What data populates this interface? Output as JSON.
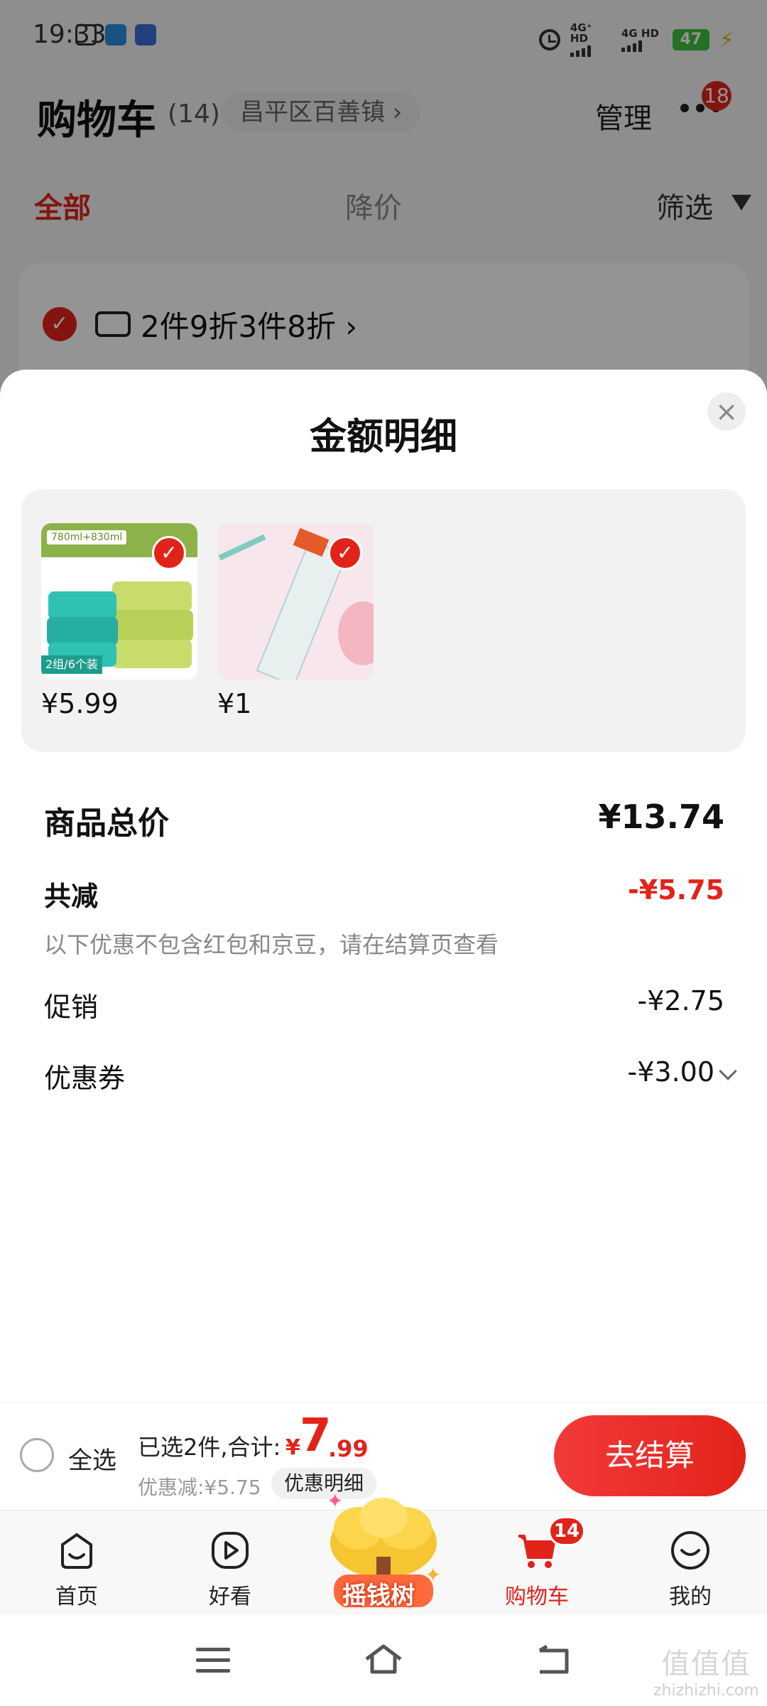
{
  "status_bar": {
    "time": "19:33",
    "signal1": "4G⁺ HD",
    "signal2": "4G HD",
    "battery": "47"
  },
  "header": {
    "title": "购物车",
    "count": "(14)",
    "location": "昌平区百善镇 ›",
    "manage": "管理",
    "badge": "18"
  },
  "tabs": {
    "all": "全部",
    "price_drop": "降价",
    "filter": "筛选"
  },
  "promo": {
    "text": "2件9折3件8折 ›"
  },
  "sheet": {
    "title": "金额明细",
    "close": "×",
    "items": [
      {
        "price": "¥5.99",
        "label_top": "780ml+830ml",
        "label_bottom": "2组/6个装"
      },
      {
        "price": "¥1"
      }
    ],
    "total_label": "商品总价",
    "total_value": "¥13.74",
    "reduce_label": "共减",
    "reduce_value": "-¥5.75",
    "note": "以下优惠不包含红包和京豆，请在结算页查看",
    "promo_label": "促销",
    "promo_value": "-¥2.75",
    "coupon_label": "优惠券",
    "coupon_value": "-¥3.00"
  },
  "checkout": {
    "select_all": "全选",
    "selected": "已选2件,合计:",
    "currency": "¥",
    "total_int": "7",
    "total_dec": ".99",
    "discount": "优惠减:¥5.75",
    "detail": "优惠明细",
    "button": "去结算"
  },
  "tabbar": {
    "home": "首页",
    "watch": "好看",
    "money_tree": "摇钱树",
    "cart": "购物车",
    "cart_badge": "14",
    "me": "我的"
  },
  "watermark": {
    "top": "值值值",
    "bottom": "zhizhizhi.com"
  },
  "colors": {
    "accent": "#e2231a",
    "checked": "#e2231a",
    "text": "#111111",
    "muted": "#888888"
  }
}
